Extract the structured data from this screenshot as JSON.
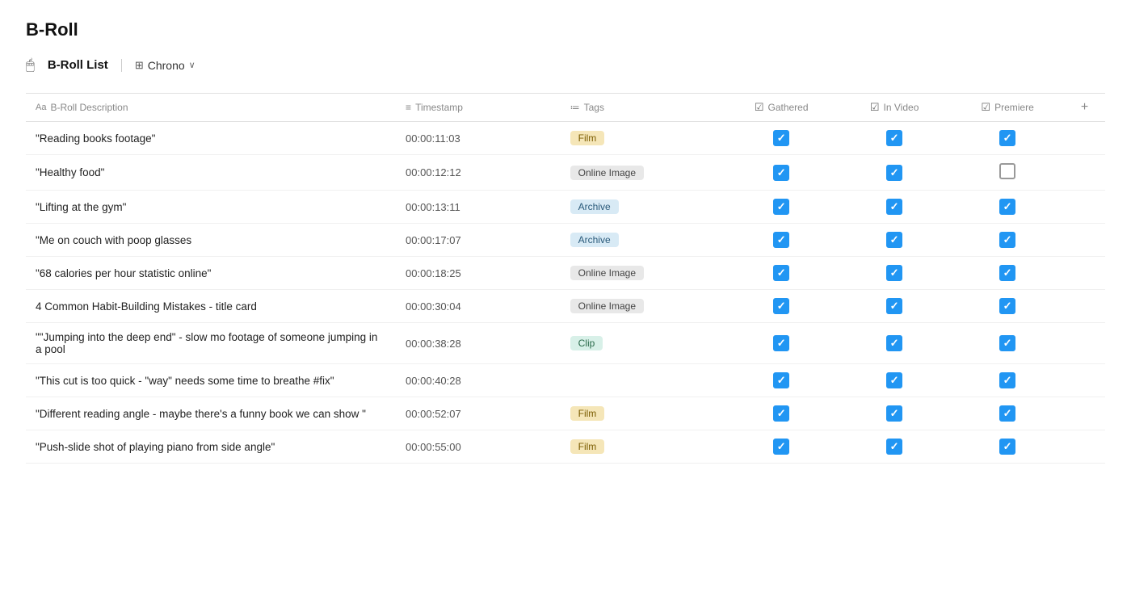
{
  "page": {
    "title": "B-Roll",
    "toolbar": {
      "icon": "🖱",
      "list_label": "B-Roll List",
      "view_icon": "⊞",
      "view_label": "Chrono",
      "chevron": "∨"
    },
    "table": {
      "columns": [
        {
          "id": "description",
          "icon": "Aa",
          "label": "B-Roll Description"
        },
        {
          "id": "timestamp",
          "icon": "≡",
          "label": "Timestamp"
        },
        {
          "id": "tags",
          "icon": "≔",
          "label": "Tags"
        },
        {
          "id": "gathered",
          "icon": "☑",
          "label": "Gathered"
        },
        {
          "id": "invideo",
          "icon": "☑",
          "label": "In Video"
        },
        {
          "id": "premiere",
          "icon": "☑",
          "label": "Premiere"
        },
        {
          "id": "add",
          "icon": "+",
          "label": ""
        }
      ],
      "rows": [
        {
          "description": "\"Reading books footage\"",
          "timestamp": "00:00:11:03",
          "tag": "Film",
          "tag_type": "film",
          "gathered": true,
          "invideo": true,
          "premiere": true
        },
        {
          "description": "\"Healthy food\"",
          "timestamp": "00:00:12:12",
          "tag": "Online Image",
          "tag_type": "online-image",
          "gathered": true,
          "invideo": true,
          "premiere": false
        },
        {
          "description": "\"Lifting at the gym\"",
          "timestamp": "00:00:13:11",
          "tag": "Archive",
          "tag_type": "archive",
          "gathered": true,
          "invideo": true,
          "premiere": true
        },
        {
          "description": "\"Me on couch with poop glasses",
          "timestamp": "00:00:17:07",
          "tag": "Archive",
          "tag_type": "archive",
          "gathered": true,
          "invideo": true,
          "premiere": true
        },
        {
          "description": "\"68 calories per hour statistic online\"",
          "timestamp": "00:00:18:25",
          "tag": "Online Image",
          "tag_type": "online-image",
          "gathered": true,
          "invideo": true,
          "premiere": true
        },
        {
          "description": "4 Common Habit-Building Mistakes - title card",
          "timestamp": "00:00:30:04",
          "tag": "Online Image",
          "tag_type": "online-image",
          "gathered": true,
          "invideo": true,
          "premiere": true
        },
        {
          "description": "\"\"Jumping into the deep end\" - slow mo footage of someone jumping in a pool",
          "timestamp": "00:00:38:28",
          "tag": "Clip",
          "tag_type": "clip",
          "gathered": true,
          "invideo": true,
          "premiere": true
        },
        {
          "description": "\"This cut is too quick - \"way\" needs some time to breathe #fix\"",
          "timestamp": "00:00:40:28",
          "tag": "",
          "tag_type": "",
          "gathered": true,
          "invideo": true,
          "premiere": true
        },
        {
          "description": "\"Different reading angle - maybe there's a funny book we can show \"",
          "timestamp": "00:00:52:07",
          "tag": "Film",
          "tag_type": "film",
          "gathered": true,
          "invideo": true,
          "premiere": true
        },
        {
          "description": "\"Push-slide shot of playing piano from side angle\"",
          "timestamp": "00:00:55:00",
          "tag": "Film",
          "tag_type": "film",
          "gathered": true,
          "invideo": true,
          "premiere": true
        }
      ]
    }
  }
}
